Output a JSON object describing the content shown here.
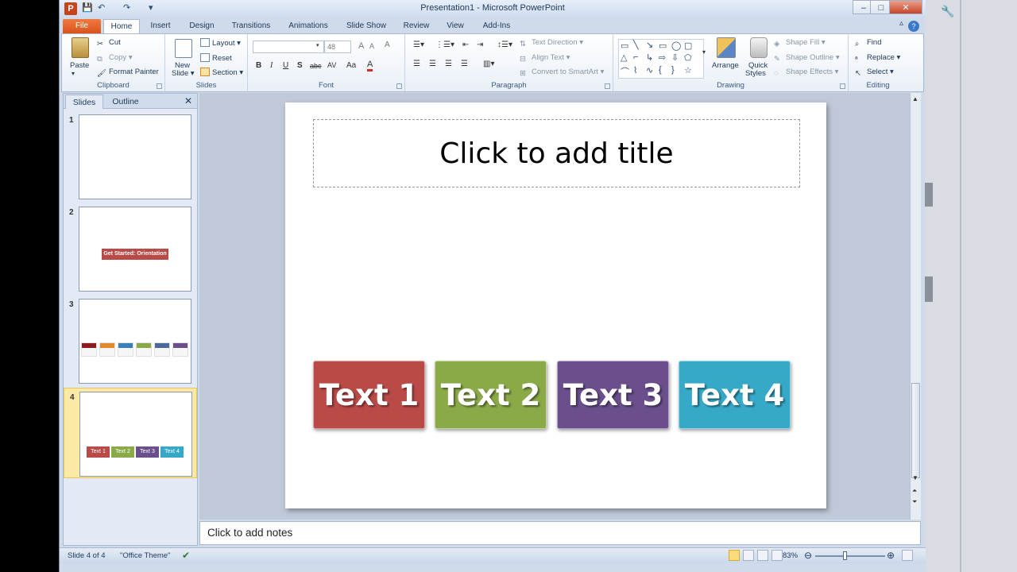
{
  "window": {
    "title": "Presentation1  -  Microsoft PowerPoint",
    "min": "–",
    "max": "□",
    "close": "✕"
  },
  "quick_access": {
    "save": "💾",
    "undo": "↶",
    "redo": "↷",
    "customize": "▾"
  },
  "tabs": [
    {
      "label": "File"
    },
    {
      "label": "Home"
    },
    {
      "label": "Insert"
    },
    {
      "label": "Design"
    },
    {
      "label": "Transitions"
    },
    {
      "label": "Animations"
    },
    {
      "label": "Slide Show"
    },
    {
      "label": "Review"
    },
    {
      "label": "View"
    },
    {
      "label": "Add-Ins"
    }
  ],
  "ribbon": {
    "clipboard": {
      "label": "Clipboard",
      "paste": "Paste",
      "cut": "Cut",
      "copy": "Copy",
      "format_painter": "Format Painter"
    },
    "slides": {
      "label": "Slides",
      "new_slide": "New",
      "new_slide2": "Slide ▾",
      "layout": "Layout ▾",
      "reset": "Reset",
      "section": "Section ▾"
    },
    "font": {
      "label": "Font",
      "font_name": "",
      "font_size": "48",
      "bold": "B",
      "italic": "I",
      "underline": "U",
      "shadow": "S",
      "strike": "abc",
      "spacing": "AV",
      "case": "Aa",
      "color": "A",
      "clear": "A"
    },
    "paragraph": {
      "label": "Paragraph",
      "text_direction": "Text Direction",
      "align_text": "Align Text",
      "convert_smartart": "Convert to SmartArt"
    },
    "drawing": {
      "label": "Drawing",
      "arrange": "Arrange",
      "quick_styles": "Quick",
      "quick_styles2": "Styles",
      "shape_fill": "Shape Fill",
      "shape_outline": "Shape Outline",
      "shape_effects": "Shape Effects"
    },
    "editing": {
      "label": "Editing",
      "find": "Find",
      "replace": "Replace",
      "select": "Select"
    }
  },
  "slides_pane": {
    "tab_slides": "Slides",
    "tab_outline": "Outline",
    "close": "✕",
    "slides": [
      {
        "num": "1"
      },
      {
        "num": "2",
        "badge": "Get Started: Orientation"
      },
      {
        "num": "3"
      },
      {
        "num": "4",
        "boxes": [
          "Text 1",
          "Text 2",
          "Text 3",
          "Text 4"
        ]
      }
    ]
  },
  "slide": {
    "title_placeholder": "Click to add title",
    "boxes": [
      {
        "label": "Text 1",
        "color": "#b94a47"
      },
      {
        "label": "Text 2",
        "color": "#8aaa48"
      },
      {
        "label": "Text 3",
        "color": "#6a4f8c"
      },
      {
        "label": "Text 4",
        "color": "#37a9c8"
      }
    ]
  },
  "notes": {
    "placeholder": "Click to add notes"
  },
  "status": {
    "slide_info": "Slide 4 of 4",
    "theme": "\"Office Theme\"",
    "zoom": "83%",
    "zoom_fraction": 0.42
  }
}
